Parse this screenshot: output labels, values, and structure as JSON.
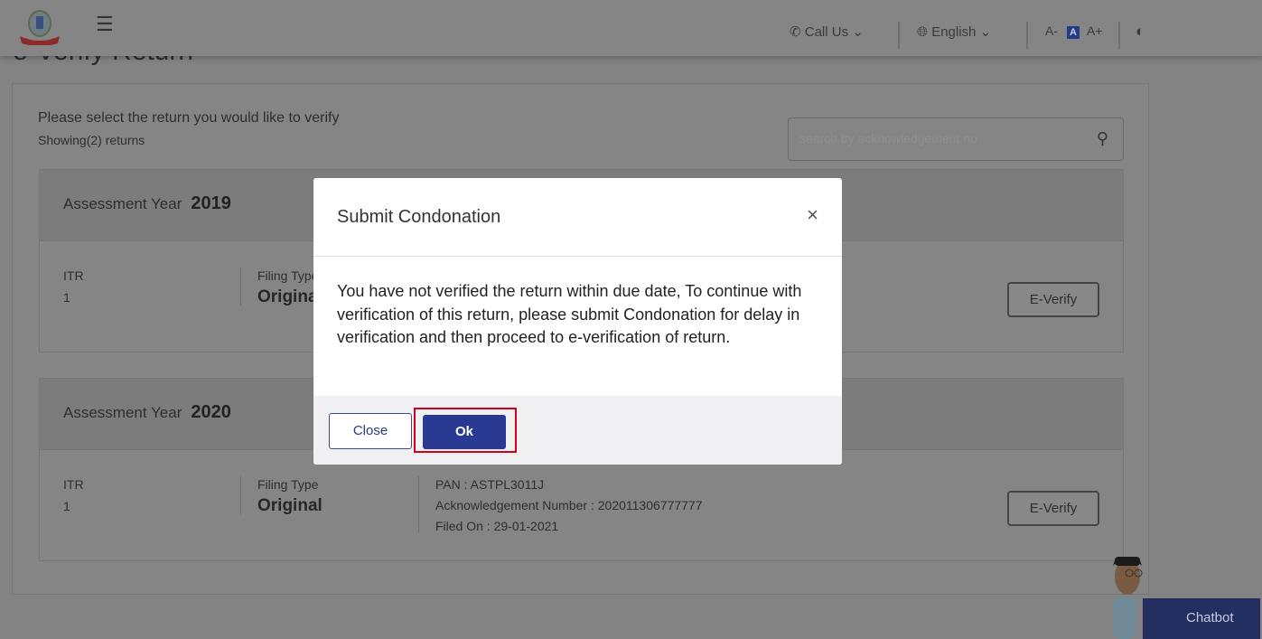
{
  "header": {
    "call_us": "Call Us",
    "language": "English",
    "font_decrease": "A-",
    "font_normal": "A",
    "font_increase": "A+"
  },
  "page": {
    "title": "e-Verify Return",
    "prompt": "Please select the return you would like to verify",
    "count": "Showing(2) returns",
    "search_placeholder": "search by acknowledgement no"
  },
  "returns": [
    {
      "ay_label": "Assessment Year",
      "ay": "2019",
      "itr_label": "ITR",
      "itr": "1",
      "filing_label": "Filing Type",
      "filing": "Original",
      "button": "E-Verify"
    },
    {
      "ay_label": "Assessment Year",
      "ay": "2020",
      "itr_label": "ITR",
      "itr": "1",
      "filing_label": "Filing Type",
      "filing": "Original",
      "pan": "PAN : ASTPL3011J",
      "ack": "Acknowledgement Number : 202011306777777",
      "filed": "Filed On : 29-01-2021",
      "button": "E-Verify"
    }
  ],
  "modal": {
    "title": "Submit Condonation",
    "body": "You have not verified the return within due date, To continue with verification of this return, please submit Condonation for delay in verification and then proceed to e-verification of return.",
    "close": "Close",
    "ok": "Ok",
    "highlight_color": "#d0021b",
    "primary_color": "#2a3a92"
  },
  "chatbot": {
    "label": "Chatbot"
  }
}
